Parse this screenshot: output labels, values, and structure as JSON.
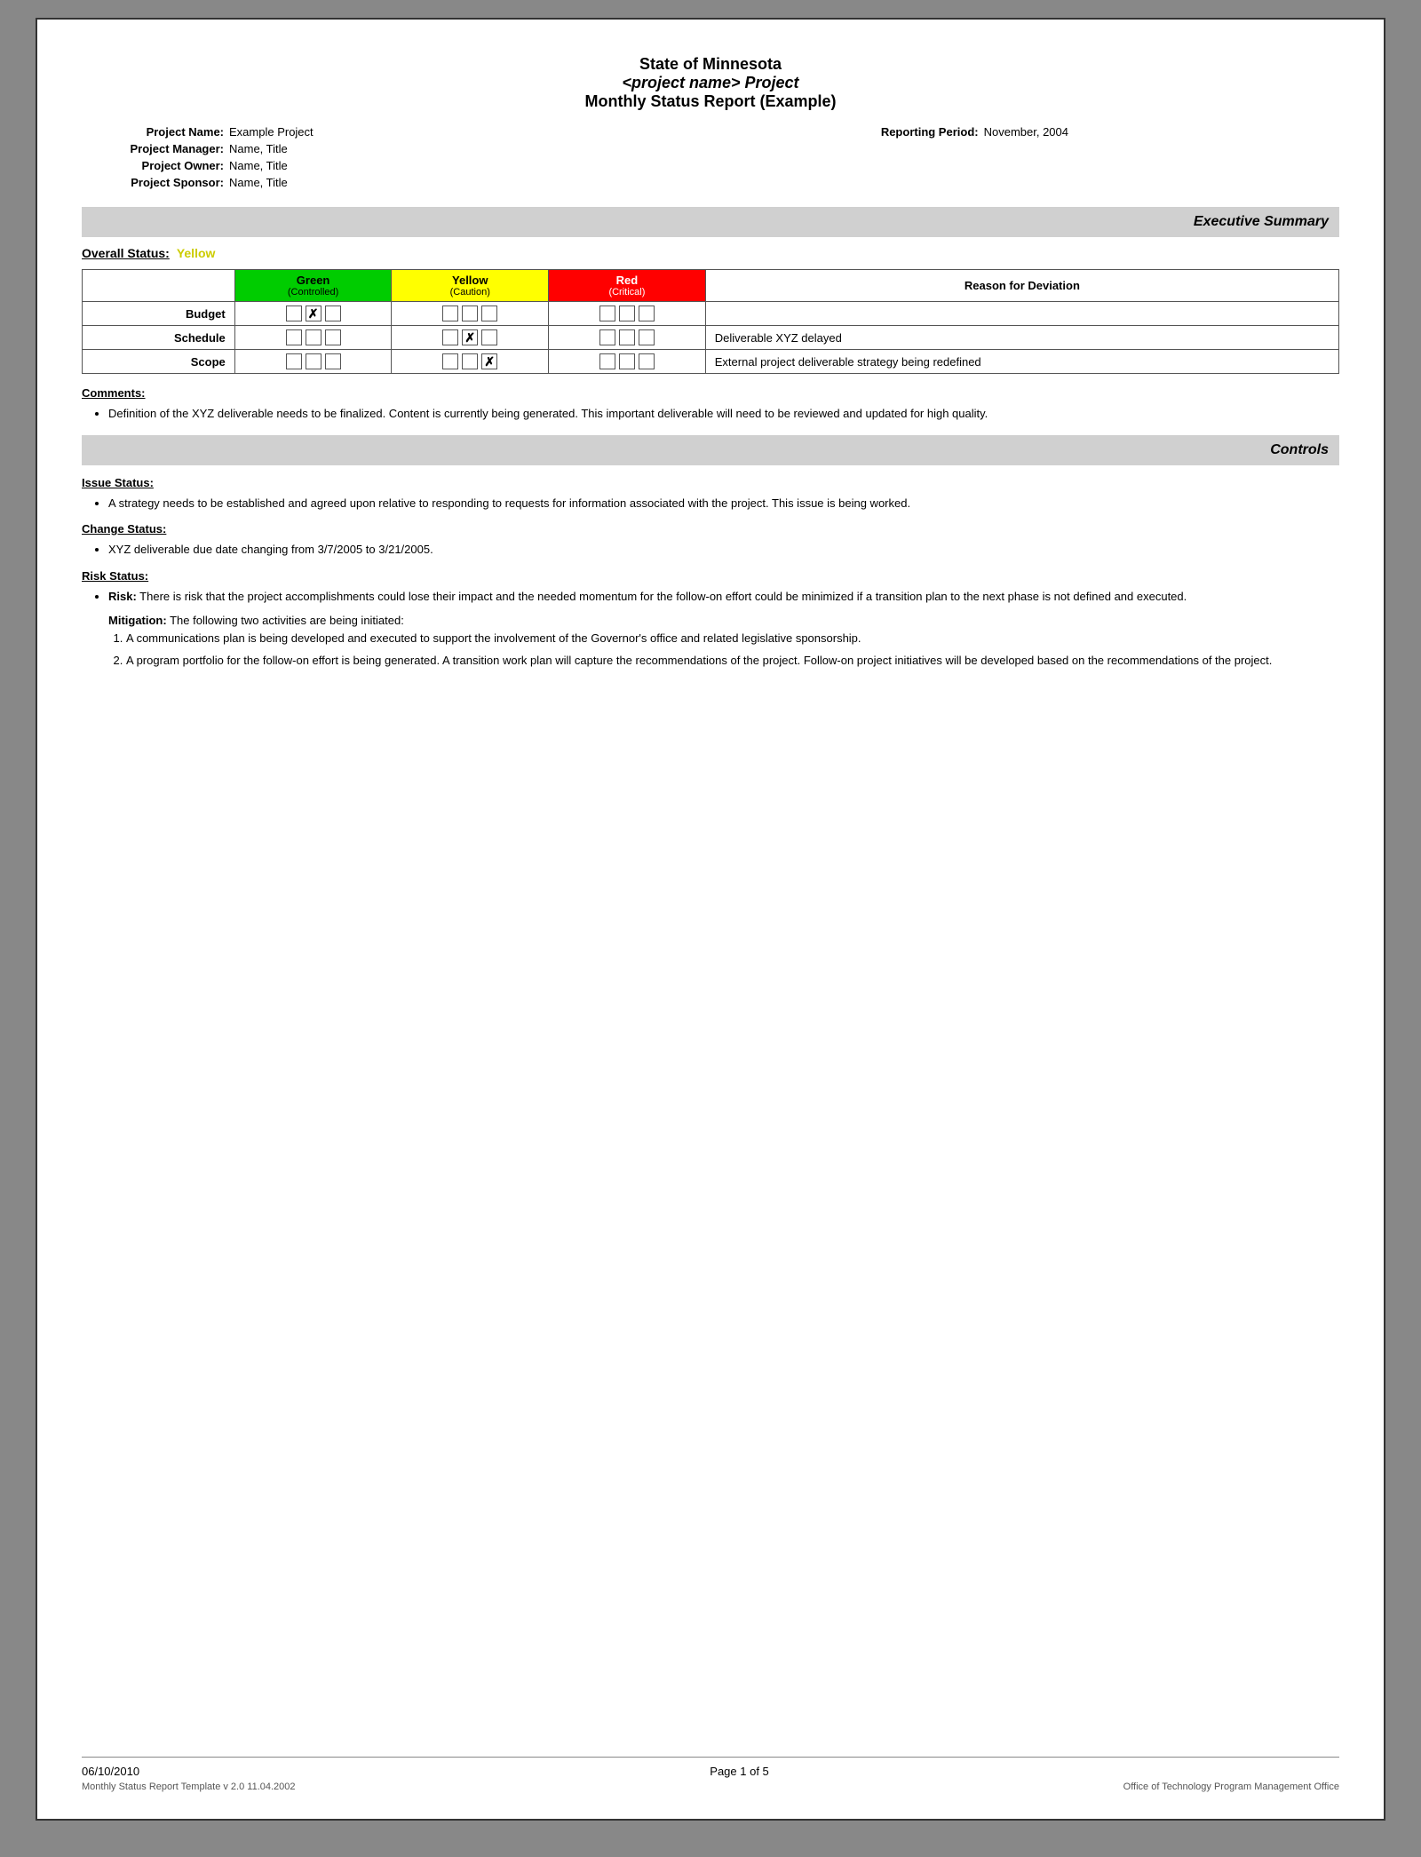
{
  "header": {
    "line1": "State of Minnesota",
    "line2": "<project name> Project",
    "line3": "Monthly Status Report (Example)"
  },
  "project_info": {
    "name_label": "Project Name:",
    "name_value": "Example Project",
    "manager_label": "Project Manager:",
    "manager_value": "Name, Title",
    "owner_label": "Project Owner:",
    "owner_value": "Name, Title",
    "sponsor_label": "Project Sponsor:",
    "sponsor_value": "Name, Title",
    "reporting_label": "Reporting Period:",
    "reporting_value": "November, 2004"
  },
  "executive_summary": {
    "section_title": "Executive Summary",
    "overall_status_label": "Overall Status:",
    "overall_status_value": "Yellow",
    "table": {
      "col_headers": [
        "Green",
        "Yellow",
        "Red"
      ],
      "col_subs": [
        "(Controlled)",
        "(Caution)",
        "(Critical)"
      ],
      "col_last": "Reason for Deviation",
      "rows": [
        {
          "label": "Budget",
          "green": [
            false,
            true,
            false
          ],
          "yellow": [
            false,
            false,
            false
          ],
          "red": [
            false,
            false,
            false
          ],
          "reason": ""
        },
        {
          "label": "Schedule",
          "green": [
            false,
            false,
            false
          ],
          "yellow": [
            false,
            true,
            false
          ],
          "red": [
            false,
            false,
            false
          ],
          "reason": "Deliverable XYZ delayed"
        },
        {
          "label": "Scope",
          "green": [
            false,
            false,
            false
          ],
          "yellow": [
            false,
            false,
            true
          ],
          "red": [
            false,
            false,
            false
          ],
          "reason": "External project deliverable strategy being redefined"
        }
      ]
    },
    "comments_label": "Comments:",
    "comments_bullet": "Definition of the XYZ deliverable needs to be finalized.  Content is currently being generated.  This important deliverable will need to be reviewed and updated for high quality."
  },
  "controls": {
    "section_title": "Controls",
    "issue_status_label": "Issue Status:",
    "issue_bullet": "A strategy needs to be established and agreed upon relative to responding to requests for information associated with the project.  This issue is being worked.",
    "change_status_label": "Change Status:",
    "change_bullet": "XYZ deliverable due date changing from 3/7/2005 to 3/21/2005.",
    "risk_status_label": "Risk Status:",
    "risk_bold": "Risk:",
    "risk_text": " There is risk that the project accomplishments could lose their impact and the needed momentum for the follow-on effort could be minimized if a transition plan to the next phase is not defined and executed.",
    "mitigation_bold": "Mitigation:",
    "mitigation_intro": " The following two activities are being initiated:",
    "mitigation_items": [
      "A communications plan is being developed and executed to support the involvement of the Governor's office and related legislative sponsorship.",
      "A program portfolio for the follow-on effort is being generated. A transition work plan will capture the recommendations of the project. Follow-on project initiatives will be developed based on the recommendations of the project."
    ]
  },
  "footer": {
    "date": "06/10/2010",
    "page": "Page 1 of 5",
    "page_num": "1",
    "page_total": "5",
    "template": "Monthly Status Report Template  v 2.0  11.04.2002",
    "office": "Office of Technology Program Management Office"
  }
}
